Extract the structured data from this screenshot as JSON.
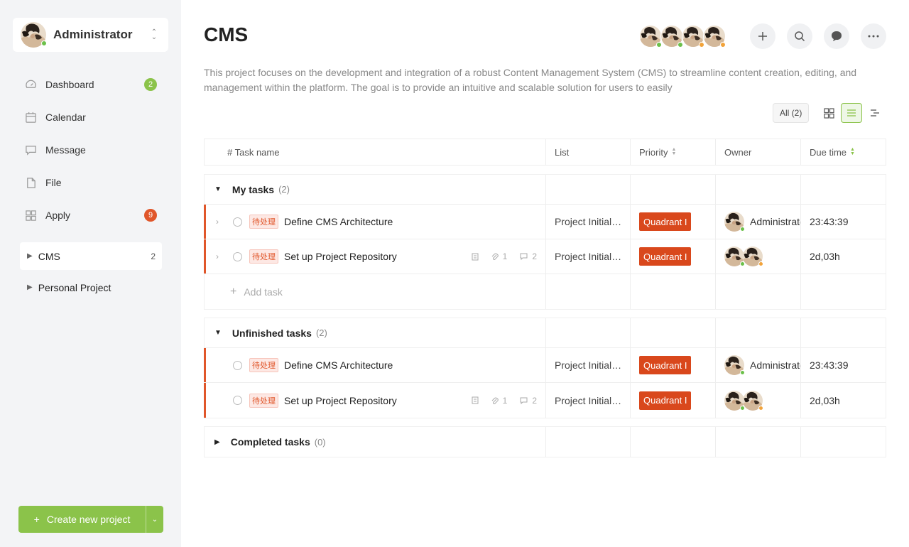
{
  "user": {
    "name": "Administrator"
  },
  "nav": [
    {
      "label": "Dashboard",
      "badge": "2",
      "icon": "gauge-icon"
    },
    {
      "label": "Calendar",
      "badge": "",
      "icon": "calendar-icon"
    },
    {
      "label": "Message",
      "badge": "",
      "icon": "chat-icon"
    },
    {
      "label": "File",
      "badge": "",
      "icon": "file-icon"
    },
    {
      "label": "Apply",
      "badge": "9",
      "icon": "grid-icon"
    }
  ],
  "projects": [
    {
      "label": "CMS",
      "count": "2"
    },
    {
      "label": "Personal Project",
      "count": ""
    }
  ],
  "create_button": {
    "label": "Create new project"
  },
  "page": {
    "title": "CMS",
    "description": "This project focuses on the development and integration of a robust Content Management System (CMS) to streamline content creation, editing, and management within the platform. The goal is to provide an intuitive and scalable solution for users to easily"
  },
  "filter": {
    "all_label": "All (2)"
  },
  "columns": {
    "task": "# Task name",
    "list": "List",
    "priority": "Priority",
    "owner": "Owner",
    "due": "Due time"
  },
  "groups": {
    "my": {
      "title": "My tasks",
      "count": "(2)",
      "tasks": [
        {
          "tag": "待处理",
          "name": "Define CMS Architecture",
          "list": "Project Initial…",
          "priority": "Quadrant I",
          "owner": "Administrator",
          "due": "23:43:39"
        },
        {
          "tag": "待处理",
          "name": "Set up Project Repository",
          "links": "1",
          "comments": "2",
          "list": "Project Initial…",
          "priority": "Quadrant I",
          "owner": "",
          "due": "2d,03h"
        }
      ],
      "add_label": "Add task"
    },
    "unfinished": {
      "title": "Unfinished tasks",
      "count": "(2)",
      "tasks": [
        {
          "tag": "待处理",
          "name": "Define CMS Architecture",
          "list": "Project Initial…",
          "priority": "Quadrant I",
          "owner": "Administrator",
          "due": "23:43:39"
        },
        {
          "tag": "待处理",
          "name": "Set up Project Repository",
          "links": "1",
          "comments": "2",
          "list": "Project Initial…",
          "priority": "Quadrant I",
          "owner": "",
          "due": "2d,03h"
        }
      ]
    },
    "completed": {
      "title": "Completed tasks",
      "count": "(0)"
    }
  },
  "colors": {
    "accent": "#8bc34a",
    "danger": "#e0562a",
    "priority": "#d9481c"
  }
}
